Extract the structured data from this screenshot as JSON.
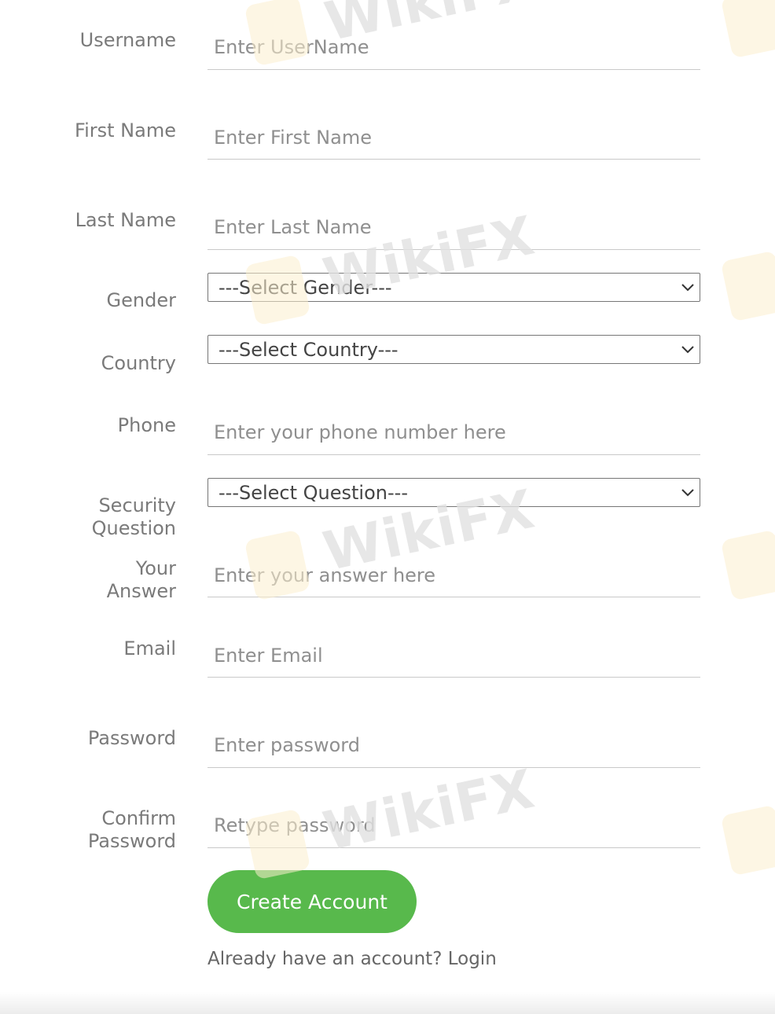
{
  "form": {
    "username": {
      "label": "Username",
      "placeholder": "Enter UserName"
    },
    "first_name": {
      "label": "First Name",
      "placeholder": "Enter First Name"
    },
    "last_name": {
      "label": "Last Name",
      "placeholder": "Enter Last Name"
    },
    "gender": {
      "label": "Gender",
      "value": "---Select Gender---"
    },
    "country": {
      "label": "Country",
      "value": "---Select Country---"
    },
    "phone": {
      "label": "Phone",
      "placeholder": "Enter your phone number here"
    },
    "security_question": {
      "label_line1": "Security",
      "label_line2": "Question",
      "value": "---Select Question---"
    },
    "answer": {
      "label_line1": "Your",
      "label_line2": "Answer",
      "placeholder": "Enter your answer here"
    },
    "email": {
      "label": "Email",
      "placeholder": "Enter Email"
    },
    "password": {
      "label": "Password",
      "placeholder": "Enter password"
    },
    "confirm_password": {
      "label_line1": "Confirm",
      "label_line2": "Password",
      "placeholder": "Retype password"
    }
  },
  "actions": {
    "create_account": "Create Account",
    "login_prompt": "Already have an account?",
    "login_link": "Login"
  },
  "watermark": {
    "text": "WikiFX"
  },
  "colors": {
    "button": "#58b94c",
    "label": "#7a7a7a",
    "placeholder": "#8f8f8f"
  }
}
